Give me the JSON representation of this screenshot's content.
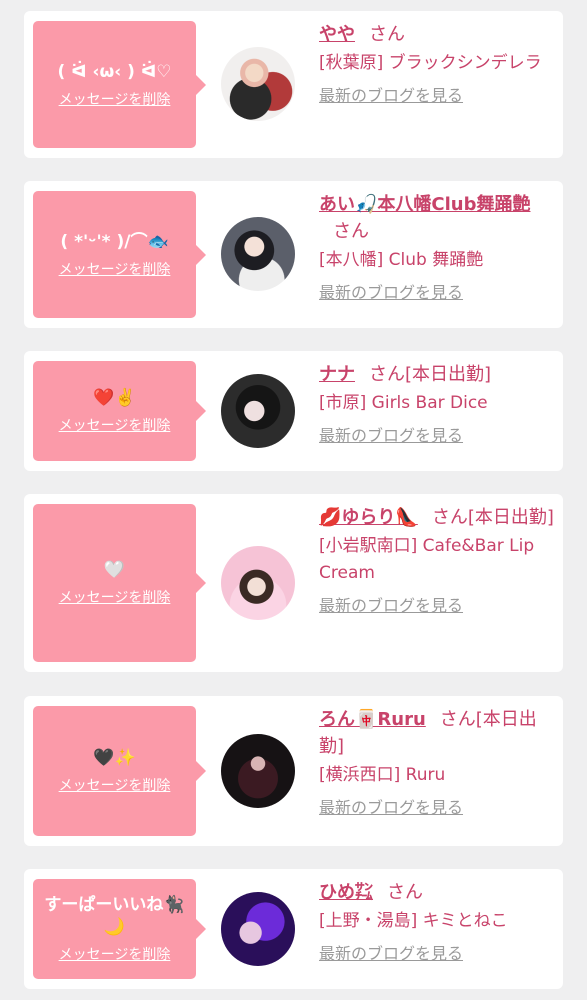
{
  "delete_label": "メッセージを削除",
  "blog_label": "最新のブログを見る",
  "cards": [
    {
      "message": "( ᐛ ‹ω‹ ) ᐛ♡",
      "name": "やや",
      "suffix": "さん",
      "shop": "[秋葉原] ブラックシンデレラ"
    },
    {
      "message": "( *'ᵕ'* )/⌒🐟",
      "name": "あい🎣本八幡Club舞踊艶",
      "suffix": "さん",
      "shop": "[本八幡] Club 舞踊艶"
    },
    {
      "message": "❤️✌️",
      "name": "ナナ",
      "suffix": "さん[本日出勤]",
      "shop": "[市原] Girls Bar Dice"
    },
    {
      "message": "🤍",
      "name": "💋ゆらり👠",
      "suffix": "さん[本日出勤]",
      "shop": "[小岩駅南口] Cafe&Bar Lip Cream"
    },
    {
      "message": "🖤✨",
      "name": "ろん🀄Ruru",
      "suffix": "さん[本日出勤]",
      "shop": "[横浜西口] Ruru"
    },
    {
      "message": "すーぱーいいね🐈‍⬛🌙",
      "name": "ひめ㌠",
      "suffix": "さん",
      "shop": "[上野・湯島] キミとねこ"
    }
  ],
  "colors": {
    "bubble": "#fb9aa9",
    "accent": "#c8436a",
    "link_gray": "#9a9a9a",
    "background": "#efeff0"
  }
}
